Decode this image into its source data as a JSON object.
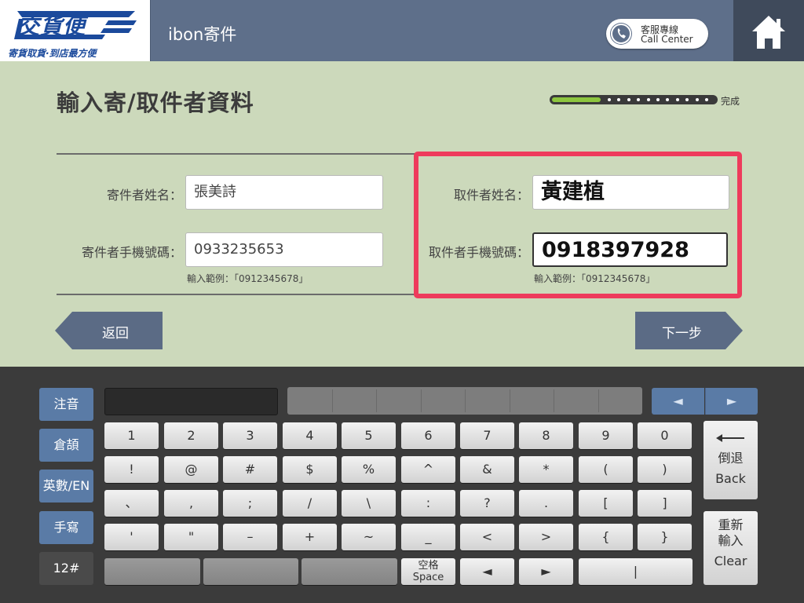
{
  "header": {
    "logo_text": "交貨便",
    "logo_tagline": "寄貨取貨·到店最方便",
    "title": "ibon寄件",
    "call_center_zh": "客服專線",
    "call_center_en": "Call Center",
    "home_icon": "home-icon"
  },
  "form": {
    "title": "輸入寄/取件者資料",
    "progress": {
      "value": 0.3,
      "end_label": "完成"
    },
    "sender_name_label": "寄件者姓名：",
    "sender_name_value": "張美詩",
    "sender_phone_label": "寄件者手機號碼：",
    "sender_phone_value": "0933235653",
    "sender_phone_hint": "輸入範例：「0912345678」",
    "recipient_name_label": "取件者姓名：",
    "recipient_name_value": "黃建植",
    "recipient_phone_label": "取件者手機號碼：",
    "recipient_phone_value": "0918397928",
    "recipient_phone_hint": "輸入範例：「0912345678」",
    "highlight_color": "#ee3b5c"
  },
  "nav": {
    "back_label": "返回",
    "next_label": "下一步"
  },
  "keyboard": {
    "modes": [
      "注音",
      "倉頡",
      "英數/EN",
      "手寫",
      "12#"
    ],
    "active_mode": "12#",
    "cand_prev": "◄",
    "cand_next": "►",
    "row1": [
      "1",
      "2",
      "3",
      "4",
      "5",
      "6",
      "7",
      "8",
      "9",
      "0"
    ],
    "row2": [
      "!",
      "@",
      "#",
      "$",
      "%",
      "^",
      "&",
      "*",
      "(",
      ")"
    ],
    "row3": [
      "、",
      ",",
      ";",
      "/",
      "\\",
      ":",
      "?",
      ".",
      "[",
      "]"
    ],
    "row4": [
      "'",
      "\"",
      "–",
      "+",
      "~",
      "_",
      "<",
      ">",
      "{",
      "}"
    ],
    "space_zh": "空格",
    "space_en": "Space",
    "cursor_left": "◄",
    "cursor_right": "►",
    "cursor_key": "|",
    "backspace_zh": "倒退",
    "backspace_en": "Back",
    "clear_zh1": "重新",
    "clear_zh2": "輸入",
    "clear_en": "Clear",
    "accent_color": "#5a7ba6"
  }
}
